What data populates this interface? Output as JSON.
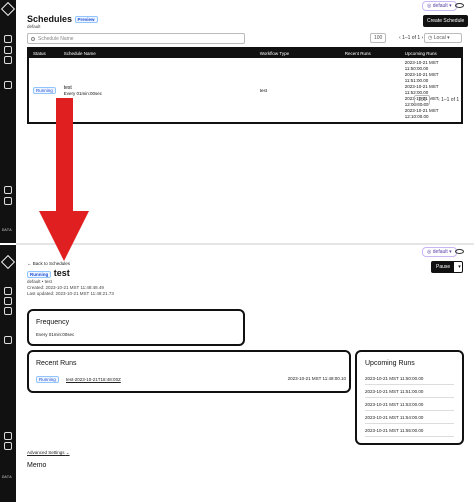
{
  "top": {
    "namespace": "default",
    "title": "Schedules",
    "badge": "Preview",
    "subtitle": "default",
    "create_button": "Create Schedule",
    "search_placeholder": "Schedule Name",
    "page_size": "100",
    "page_info": "1–1 of 1",
    "timezone": "Local",
    "columns": [
      "Status",
      "Schedule Name",
      "Workflow Type",
      "Recent Runs",
      "Upcoming Runs"
    ],
    "row": {
      "status": "Running",
      "name": "test",
      "spec": "Every 01min:00sec",
      "workflow_type": "test",
      "recent_runs": "",
      "upcoming": [
        "2023-10-21 MST 11:50:00.00",
        "2023-10-21 MST 11:51:00.00",
        "2023-10-21 MST 11:52:00.00",
        "2023-10-21 MST 12:00:00.00",
        "2023-10-21 MST 12:10:00.00"
      ]
    },
    "bottom_page_size": "100",
    "bottom_page_info": "1–1 of 1"
  },
  "sidebar": {
    "label_top": "DATA",
    "label_bottom": "DATA"
  },
  "detail": {
    "namespace": "default",
    "back_link": "← Back to Schedules",
    "status": "Running",
    "title": "test",
    "meta_line1": "default  •  test",
    "created": "Created: 2023-10-21 MST 11:48:48.49",
    "updated": "Last updated: 2023-10-21 MST 11:48:21.73",
    "pause_button": "Pause",
    "frequency": {
      "title": "Frequency",
      "text": "Every 01min:00sec"
    },
    "recent_runs": {
      "title": "Recent Runs",
      "status": "Running",
      "run_id": "test-2023-10-21T18:48:00Z",
      "time": "2023-10-21 MST 11:48:00.10"
    },
    "upcoming_runs": {
      "title": "Upcoming Runs",
      "items": [
        "2023-10-21 MST 11:50:00.00",
        "2023-10-21 MST 11:51:00.00",
        "2023-10-21 MST 11:53:00.00",
        "2023-10-21 MST 11:54:00.00",
        "2023-10-21 MST 11:55:00.00"
      ]
    },
    "advanced_settings": "Advanced Settings",
    "memo": "Memo"
  },
  "annotation": {
    "arrow_color": "#e02020"
  }
}
